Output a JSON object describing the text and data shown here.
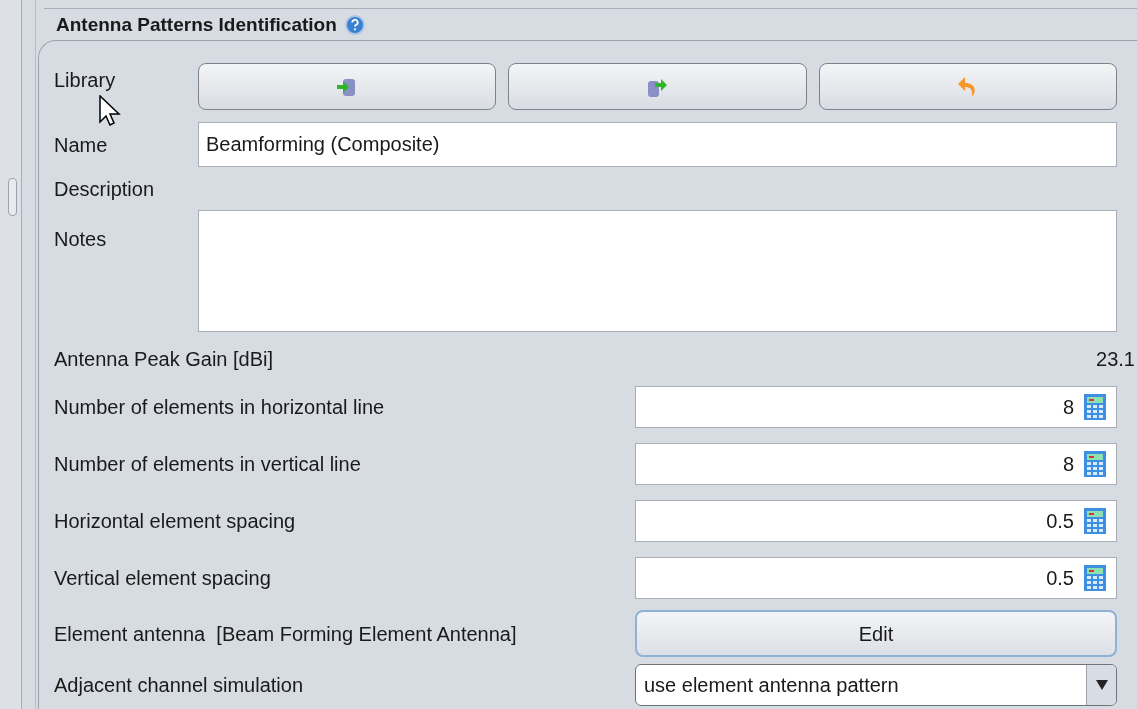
{
  "section": {
    "title": "Antenna Patterns Identification"
  },
  "library": {
    "label": "Library"
  },
  "name": {
    "label": "Name",
    "value": "Beamforming (Composite)"
  },
  "description": {
    "label": "Description"
  },
  "notes": {
    "label": "Notes"
  },
  "peak_gain": {
    "label": "Antenna Peak Gain [dBi]",
    "value": "23.1"
  },
  "parameters": [
    {
      "label": "Number of elements in horizontal line",
      "value": "8"
    },
    {
      "label": "Number of elements in vertical line",
      "value": "8"
    },
    {
      "label": "Horizontal element spacing",
      "value": "0.5"
    },
    {
      "label": "Vertical element spacing",
      "value": "0.5"
    }
  ],
  "element_antenna": {
    "label": "Element antenna  [Beam Forming Element Antenna]",
    "button": "Edit"
  },
  "adjacent_channel": {
    "label": "Adjacent channel simulation",
    "value": "use element antenna pattern"
  }
}
